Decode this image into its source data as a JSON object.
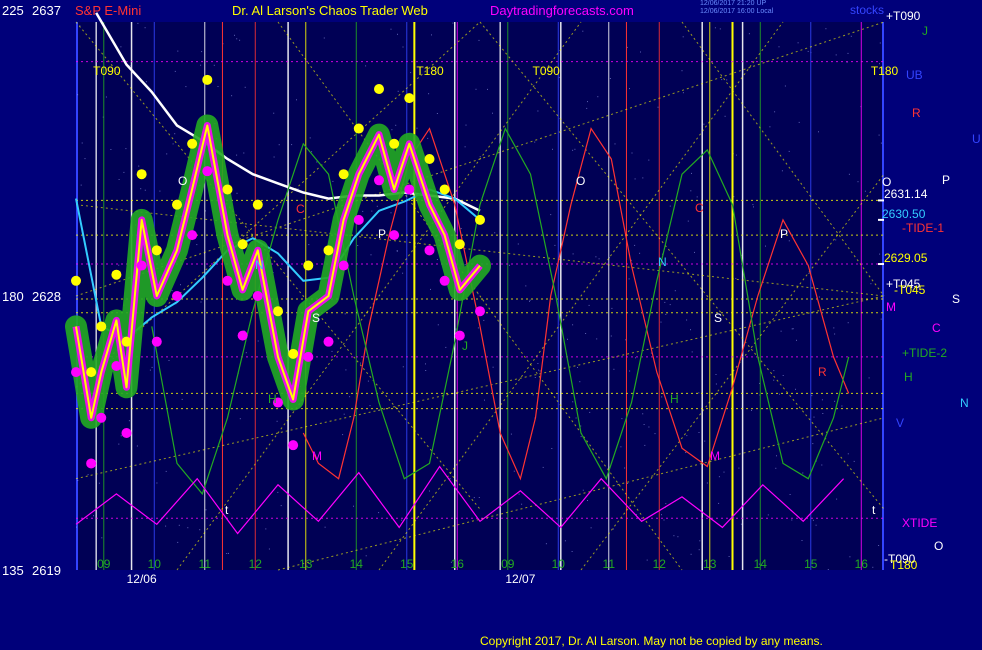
{
  "header": {
    "scale_left": "225",
    "price_top": "2637",
    "symbol": "S&P E-Mini",
    "title": "Dr. Al Larson's Chaos Trader Web",
    "site": "Daytradingforecasts.com",
    "stamp_line1": "12/06/2017 21:20 UP",
    "stamp_line2": "12/06/2017 16:00 Local",
    "corner": "stocks"
  },
  "colors": {
    "background": "#00007a",
    "plot_bg": "#000055",
    "yellow": "#ffff00",
    "magenta": "#ff00ff",
    "green": "#22aa22",
    "white": "#ffffff",
    "cyan": "#33ccff",
    "red": "#ff3333",
    "blue": "#3344ff"
  },
  "footer": {
    "copyright": "Copyright 2017, Dr. Al Larson. May not be copied by any means."
  },
  "chart_data": {
    "type": "line",
    "title": "S&P E-Mini",
    "y_axis": {
      "ticks": [
        {
          "scale": "225",
          "price": "2637"
        },
        {
          "scale": "180",
          "price": "2628"
        },
        {
          "scale": "135",
          "price": "2619"
        }
      ],
      "ylim": [
        2619,
        2637
      ]
    },
    "x_axis": {
      "dates": [
        "12/06",
        "12/07"
      ],
      "hour_ticks": [
        "09",
        "10",
        "11",
        "12",
        "13",
        "14",
        "15",
        "16",
        "09",
        "10",
        "11",
        "12",
        "13",
        "14",
        "15",
        "16"
      ]
    },
    "timing_labels": [
      "T090",
      "T180",
      "T090",
      "T180"
    ],
    "right_labels": [
      {
        "text": "+T090",
        "color": "#ffffff"
      },
      {
        "text": "J",
        "color": "#22aa22"
      },
      {
        "text": "UB",
        "color": "#3344ff"
      },
      {
        "text": "R",
        "color": "#ff3333"
      },
      {
        "text": "U",
        "color": "#3344ff"
      },
      {
        "text": "O",
        "color": "#ffffff"
      },
      {
        "text": "P",
        "color": "#ffffff"
      },
      {
        "text": "2631.14",
        "color": "#ffffff"
      },
      {
        "text": "2630.50",
        "color": "#33ccff"
      },
      {
        "text": "-TIDE-1",
        "color": "#ff3333"
      },
      {
        "text": "2629.05",
        "color": "#ffff00"
      },
      {
        "text": "+T045",
        "color": "#ffffff"
      },
      {
        "text": "-T045",
        "color": "#ffff00"
      },
      {
        "text": "S",
        "color": "#ffffff"
      },
      {
        "text": "M",
        "color": "#ff00ff"
      },
      {
        "text": "C",
        "color": "#ff00ff"
      },
      {
        "text": "+TIDE-2",
        "color": "#22aa22"
      },
      {
        "text": "H",
        "color": "#22aa22"
      },
      {
        "text": "N",
        "color": "#33ccff"
      },
      {
        "text": "V",
        "color": "#3344ff"
      },
      {
        "text": "XTIDE",
        "color": "#ff00ff"
      },
      {
        "text": "O",
        "color": "#ffffff"
      },
      {
        "text": "-T090",
        "color": "#ffffff"
      },
      {
        "text": "T180",
        "color": "#ffff00"
      }
    ],
    "planet_labels_in_plot": [
      {
        "text": "O",
        "color": "#ffffff"
      },
      {
        "text": "C",
        "color": "#ff3333"
      },
      {
        "text": "P",
        "color": "#ffffff"
      },
      {
        "text": "S",
        "color": "#ffffff"
      },
      {
        "text": "M",
        "color": "#ff00ff"
      },
      {
        "text": "N",
        "color": "#33ccff"
      },
      {
        "text": "H",
        "color": "#22aa22"
      },
      {
        "text": "J",
        "color": "#22aa22"
      },
      {
        "text": "t",
        "color": "#ffffff"
      },
      {
        "text": "O",
        "color": "#ffffff"
      },
      {
        "text": "C",
        "color": "#ff3333"
      },
      {
        "text": "N",
        "color": "#33ccff"
      },
      {
        "text": "S",
        "color": "#ffffff"
      },
      {
        "text": "P",
        "color": "#ffffff"
      },
      {
        "text": "H",
        "color": "#22aa22"
      },
      {
        "text": "M",
        "color": "#ff00ff"
      },
      {
        "text": "R",
        "color": "#ff3333"
      },
      {
        "text": "t",
        "color": "#ffffff"
      }
    ],
    "series": [
      {
        "name": "price",
        "color": "#ffff00",
        "x": [
          0,
          0.3,
          0.5,
          0.8,
          1.0,
          1.3,
          1.6,
          2.0,
          2.3,
          2.6,
          3.0,
          3.3,
          3.6,
          4.0,
          4.3,
          4.6,
          5.0,
          5.3,
          5.6,
          6.0,
          6.3,
          6.6,
          7.0,
          7.3,
          7.6,
          8.0
        ],
        "y": [
          2627.0,
          2624.0,
          2625.5,
          2627.2,
          2625.0,
          2630.5,
          2628.0,
          2629.5,
          2631.5,
          2633.6,
          2630.0,
          2628.2,
          2629.5,
          2626.0,
          2624.6,
          2627.5,
          2628.0,
          2630.5,
          2632.0,
          2633.3,
          2631.5,
          2633.0,
          2631.0,
          2630.0,
          2628.2,
          2629.0
        ]
      },
      {
        "name": "white average",
        "color": "#ffffff",
        "x": [
          0.4,
          1.0,
          1.5,
          2.0,
          2.5,
          3.0,
          3.5,
          4.0,
          4.5,
          5.0,
          5.5,
          6.0,
          6.5,
          7.0,
          7.5,
          8.0
        ],
        "y": [
          2637.3,
          2635.6,
          2634.7,
          2633.6,
          2633.1,
          2632.5,
          2632.0,
          2631.7,
          2631.4,
          2631.2,
          2631.3,
          2631.3,
          2631.4,
          2631.3,
          2631.2,
          2630.8
        ]
      },
      {
        "name": "cyan average",
        "color": "#33ccff",
        "x": [
          0,
          0.5,
          1.0,
          1.5,
          2.0,
          2.5,
          3.0,
          3.5,
          4.0,
          4.5,
          5.0,
          5.5,
          6.0,
          6.5,
          7.0,
          7.5,
          8.0
        ],
        "y": [
          2631.2,
          2627.0,
          2626.6,
          2627.3,
          2627.8,
          2628.6,
          2629.5,
          2629.9,
          2629.4,
          2628.5,
          2628.6,
          2629.9,
          2630.8,
          2631.1,
          2631.5,
          2631.2,
          2630.5
        ]
      },
      {
        "name": "-TIDE-1",
        "color": "#ff3333",
        "x": [
          4.5,
          4.8,
          5.2,
          5.5,
          5.8,
          6.2,
          6.6,
          7.0,
          7.5,
          8.0,
          8.4,
          8.8,
          9.1,
          9.4,
          9.8,
          10.2,
          10.6,
          11.0,
          11.5,
          12.0,
          12.5,
          13.0,
          13.5,
          14.0,
          14.5,
          15.0,
          15.3
        ],
        "y": [
          2623.5,
          2622.5,
          2622.0,
          2624.0,
          2627.0,
          2630.0,
          2632.5,
          2633.5,
          2631.0,
          2627.0,
          2623.5,
          2622.0,
          2624.0,
          2628.0,
          2631.0,
          2633.5,
          2632.5,
          2629.0,
          2625.5,
          2623.0,
          2622.4,
          2625.0,
          2628.0,
          2630.5,
          2629.0,
          2626.0,
          2624.8
        ]
      },
      {
        "name": "+TIDE-2",
        "color": "#22aa22",
        "x": [
          1.5,
          2.0,
          2.5,
          3.0,
          3.5,
          4.0,
          4.5,
          5.0,
          5.5,
          6.0,
          6.5,
          7.0,
          7.5,
          8.0,
          8.5,
          9.0,
          9.5,
          10.0,
          10.5,
          11.0,
          11.5,
          12.0,
          12.5,
          13.0,
          13.5,
          14.0,
          14.5,
          15.0,
          15.3
        ],
        "y": [
          2627.0,
          2622.5,
          2621.5,
          2624.0,
          2627.5,
          2630.5,
          2633.0,
          2632.0,
          2628.0,
          2624.5,
          2622.0,
          2622.5,
          2626.5,
          2631.0,
          2633.5,
          2632.0,
          2628.0,
          2623.5,
          2622.0,
          2624.5,
          2628.5,
          2632.0,
          2632.8,
          2631.0,
          2626.0,
          2622.5,
          2622.0,
          2624.0,
          2626.0
        ]
      },
      {
        "name": "XTIDE",
        "color": "#ff00ff",
        "x": [
          0,
          0.8,
          1.6,
          2.4,
          3.2,
          4.0,
          4.8,
          5.6,
          6.4,
          7.2,
          8.0,
          8.8,
          9.6,
          10.4,
          11.2,
          12.0,
          12.8,
          13.6,
          14.4,
          15.2
        ],
        "y": [
          2620.5,
          2621.5,
          2620.5,
          2622.0,
          2620.2,
          2621.8,
          2620.6,
          2622.2,
          2620.4,
          2622.4,
          2620.6,
          2621.6,
          2620.4,
          2622.0,
          2620.6,
          2621.4,
          2620.4,
          2621.8,
          2620.6,
          2622.0
        ]
      }
    ],
    "value_markers": [
      2631.14,
      2630.5,
      2629.05
    ],
    "grid": true,
    "legend": "right"
  }
}
